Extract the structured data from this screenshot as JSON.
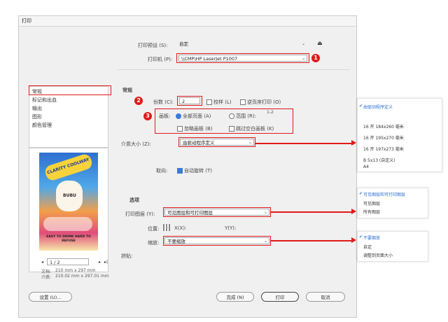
{
  "window": {
    "title": "打印"
  },
  "top": {
    "preset_label": "打印预设 (S):",
    "preset_value": "自定",
    "printer_label": "打印机 (P):",
    "printer_value": "\\\\CMP\\HP LaserJet P1007"
  },
  "sidebar": {
    "items": [
      {
        "label": "常规"
      },
      {
        "label": "标记和出血"
      },
      {
        "label": "输出"
      },
      {
        "label": "图形"
      },
      {
        "label": "颜色管理"
      }
    ]
  },
  "general": {
    "section_title": "常规",
    "copies_label": "份数 (C):",
    "copies_value": "2",
    "collate_label": "校样 (L)",
    "reverse_label": "逆页序打印 (O)",
    "pages_label": "画板:",
    "all_pages_label": "全部页面 (A)",
    "range_label": "范围 (R):",
    "range_value": "1-2",
    "ignore_label": "忽略画板 (B)",
    "skip_blank_label": "跳过空白画板 (K)",
    "media_label": "介质大小 (Z):",
    "media_value": "由驱动程序定义",
    "orientation_label": "取向:",
    "auto_rotate_label": "自动旋转 (T)"
  },
  "options": {
    "section_title": "选项",
    "print_layers_label": "打印图层 (Y):",
    "print_layers_value": "可见图层和可打印图层",
    "position_label": "位置:",
    "x_label": "X(X):",
    "y_label": "Y(Y):",
    "scaling_label": "缩放:",
    "scaling_value": "不要缩放",
    "tiling_label": "拼贴:"
  },
  "preview": {
    "page_input": "1 / 2",
    "doc_label": "文档:",
    "doc_value": "210 mm x 297 mm",
    "media_label": "介质:",
    "media_value": "210.02 mm x 297.01 mm",
    "poster": {
      "title": "CLARITY COOLWAY",
      "brand": "BUBU",
      "caption": "EASY TO DRINK HARD TO REFUSE"
    }
  },
  "buttons": {
    "setup": "设置 (U)...",
    "done": "完成 (N)",
    "print": "打印",
    "cancel": "取消"
  },
  "badges": {
    "one": "1",
    "two": "2",
    "three": "3"
  },
  "media_dropdown": {
    "items": [
      {
        "label": "由驱动程序定义",
        "selected": true
      },
      {
        "label": "16 开 184x260 毫米",
        "selected": false
      },
      {
        "label": "16 开 195x270 毫米",
        "selected": false
      },
      {
        "label": "16 开 197x273 毫米",
        "selected": false
      },
      {
        "label": "B 5x13 (自定义)",
        "selected": false
      },
      {
        "label": "A4",
        "selected": false
      }
    ]
  },
  "layers_dropdown": {
    "items": [
      {
        "label": "可见图层和可打印图层",
        "selected": true
      },
      {
        "label": "可见图层",
        "selected": false
      },
      {
        "label": "所有图层",
        "selected": false
      }
    ]
  },
  "scaling_dropdown": {
    "items": [
      {
        "label": "不要缩放",
        "selected": true
      },
      {
        "label": "自定",
        "selected": false
      },
      {
        "label": "调整到页面大小",
        "selected": false
      }
    ]
  },
  "colors": {
    "accent_red": "#e01a1a",
    "selection_blue": "#2d6fd1"
  }
}
